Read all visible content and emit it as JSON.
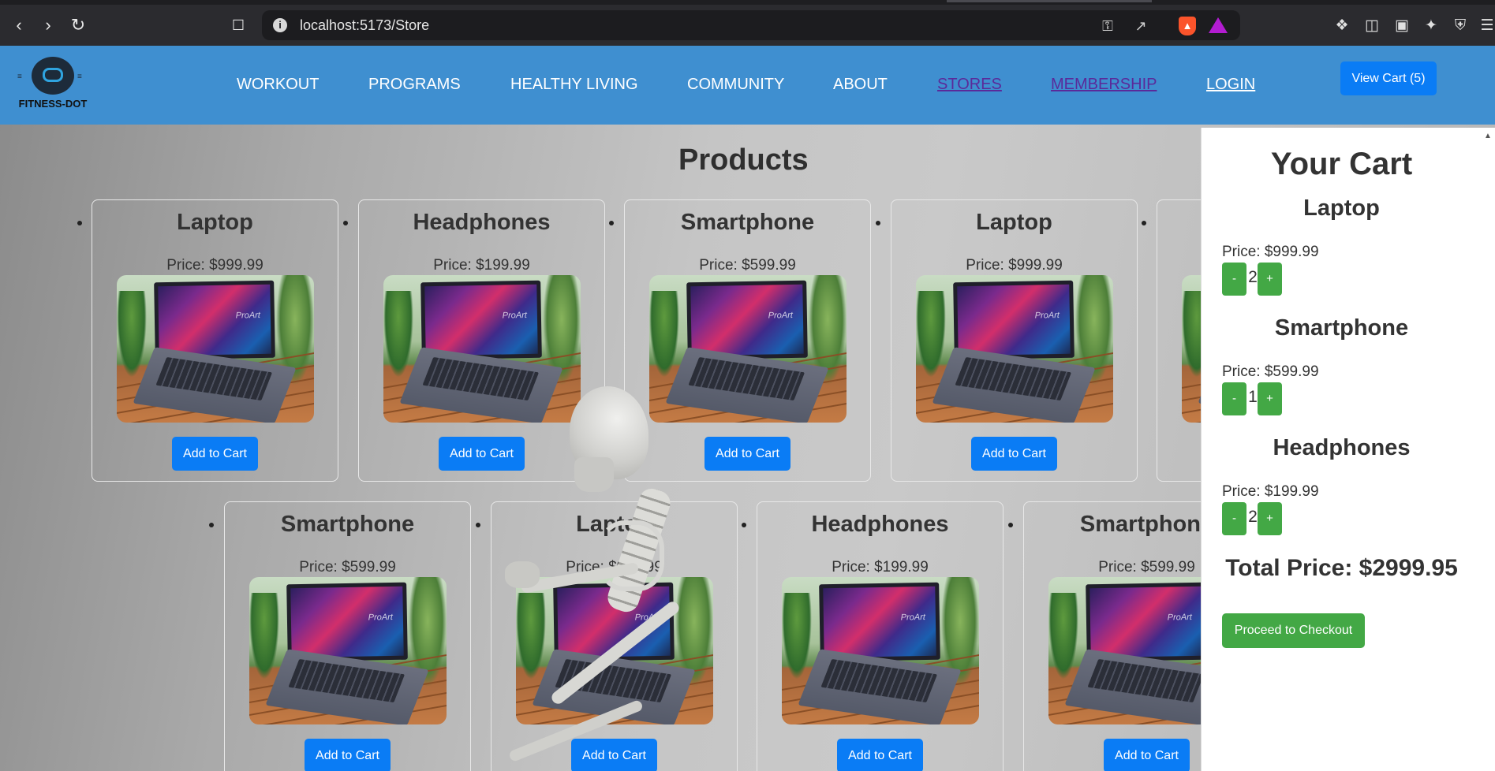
{
  "browser": {
    "url": "localhost:5173/Store",
    "back_icon": "chevron-left-icon",
    "forward_icon": "chevron-right-icon",
    "reload_icon": "reload-icon",
    "bookmark_icon": "bookmark-icon",
    "site_info_icon": "info-icon",
    "toolbar_icons": [
      "key-icon",
      "share-icon",
      "brave-shield-icon",
      "brave-rewards-icon",
      "extensions-icon",
      "sidebar-icon",
      "wallet-icon",
      "leo-ai-icon",
      "vpn-icon",
      "menu-icon"
    ]
  },
  "header": {
    "logo_text": "FITNESS-DOT",
    "nav": [
      {
        "label": "WORKOUT"
      },
      {
        "label": "PROGRAMS"
      },
      {
        "label": "HEALTHY LIVING"
      },
      {
        "label": "COMMUNITY"
      },
      {
        "label": "ABOUT"
      },
      {
        "label": "STORES"
      },
      {
        "label": "MEMBERSHIP"
      },
      {
        "label": "LOGIN"
      }
    ],
    "view_cart_label": "View Cart (5)",
    "colors": {
      "header_bg": "#3f8fd0",
      "button_blue": "#0a7cf5",
      "visited_link": "#5a2a9a",
      "green": "#43a845"
    }
  },
  "products": {
    "title": "Products",
    "add_label": "Add to Cart",
    "items": [
      {
        "name": "Laptop",
        "price": "Price: $999.99"
      },
      {
        "name": "Headphones",
        "price": "Price: $199.99"
      },
      {
        "name": "Smartphone",
        "price": "Price: $599.99"
      },
      {
        "name": "Laptop",
        "price": "Price: $999.99"
      },
      {
        "name": "Smartphone",
        "price": "Price: $599.99"
      },
      {
        "name": "Laptop",
        "price": "Price: $999.99"
      },
      {
        "name": "Headphones",
        "price": "Price: $199.99"
      },
      {
        "name": "Smartphone",
        "price": "Price: $599.99"
      }
    ],
    "image_brand": "ProArt"
  },
  "cart": {
    "title": "Your Cart",
    "items": [
      {
        "name": "Laptop",
        "price": "Price: $999.99",
        "qty": "2"
      },
      {
        "name": "Smartphone",
        "price": "Price: $599.99",
        "qty": "1"
      },
      {
        "name": "Headphones",
        "price": "Price: $199.99",
        "qty": "2"
      }
    ],
    "minus_label": "-",
    "plus_label": "+",
    "total": "Total Price: $2999.95",
    "checkout_label": "Proceed to Checkout"
  }
}
